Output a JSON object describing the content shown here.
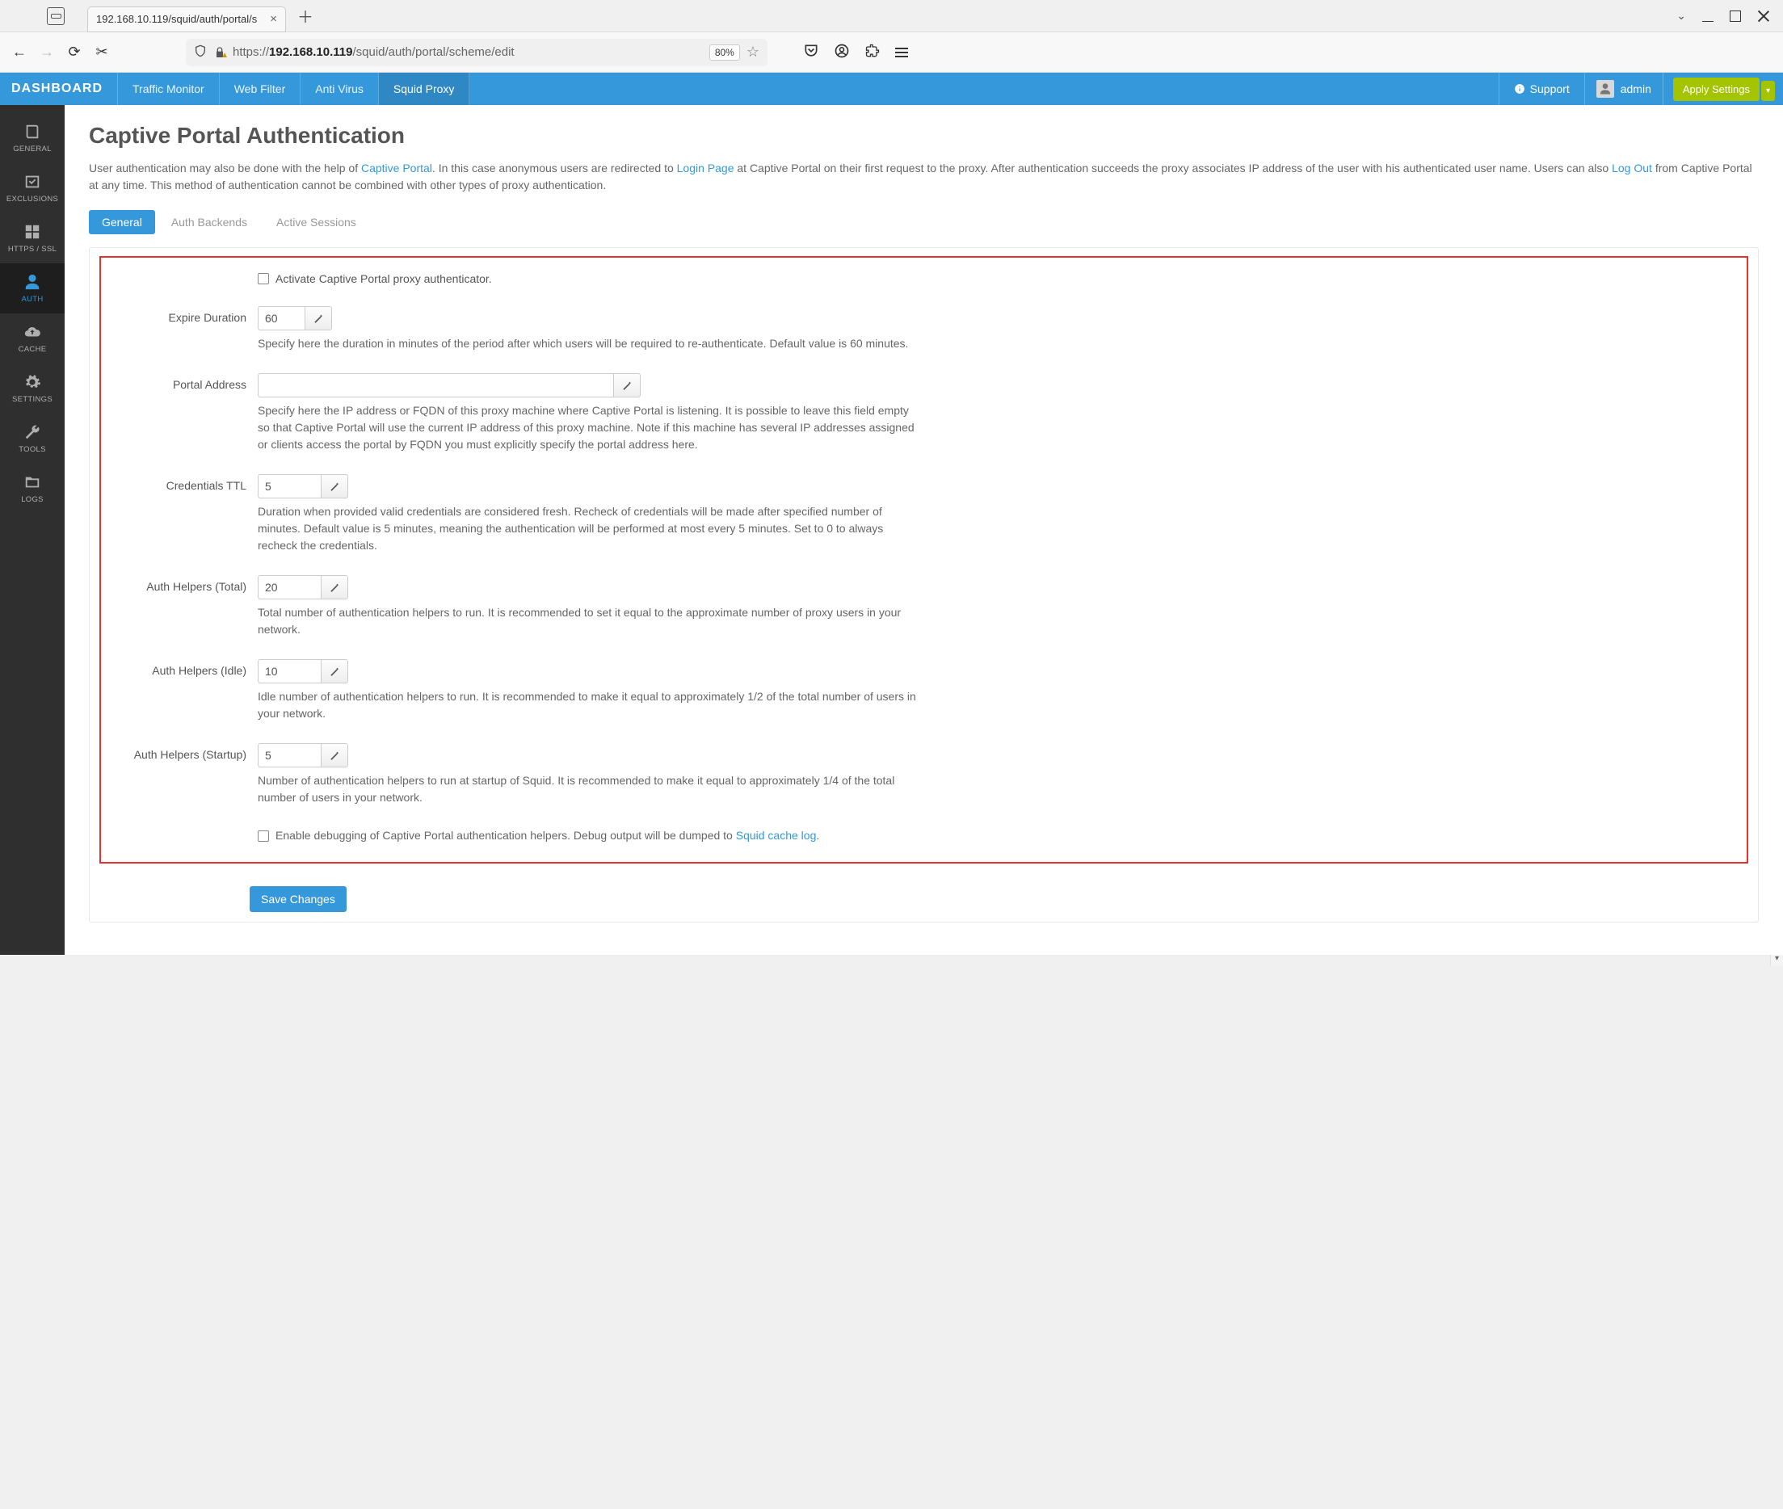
{
  "browser": {
    "tab_title": "192.168.10.119/squid/auth/portal/s",
    "url_prefix": "https://",
    "url_host": "192.168.10.119",
    "url_path": "/squid/auth/portal/scheme/edit",
    "zoom": "80%"
  },
  "topbar": {
    "brand": "DASHBOARD",
    "nav": {
      "traffic": "Traffic Monitor",
      "webfilter": "Web Filter",
      "antivirus": "Anti Virus",
      "squid": "Squid Proxy"
    },
    "support": "Support",
    "user": "admin",
    "apply": "Apply Settings"
  },
  "sidebar": {
    "general": "GENERAL",
    "exclusions": "EXCLUSIONS",
    "httpsssl": "HTTPS / SSL",
    "auth": "AUTH",
    "cache": "CACHE",
    "settings": "SETTINGS",
    "tools": "TOOLS",
    "logs": "LOGS"
  },
  "page": {
    "title": "Captive Portal Authentication",
    "intro_1": "User authentication may also be done with the help of ",
    "link_cp": "Captive Portal",
    "intro_2": ". In this case anonymous users are redirected to ",
    "link_login": "Login Page",
    "intro_3": " at Captive Portal on their first request to the proxy. After authentication succeeds the proxy associates IP address of the user with his authenticated user name. Users can also ",
    "link_logout": "Log Out",
    "intro_4": " from Captive Portal at any time. This method of authentication cannot be combined with other types of proxy authentication."
  },
  "tabs": {
    "general": "General",
    "backends": "Auth Backends",
    "sessions": "Active Sessions"
  },
  "form": {
    "activate_label": "Activate Captive Portal proxy authenticator.",
    "expire_label": "Expire Duration",
    "expire_value": "60",
    "expire_help": "Specify here the duration in minutes of the period after which users will be required to re-authenticate. Default value is 60 minutes.",
    "portal_label": "Portal Address",
    "portal_value": "",
    "portal_help": "Specify here the IP address or FQDN of this proxy machine where Captive Portal is listening. It is possible to leave this field empty so that Captive Portal will use the current IP address of this proxy machine. Note if this machine has several IP addresses assigned or clients access the portal by FQDN you must explicitly specify the portal address here.",
    "ttl_label": "Credentials TTL",
    "ttl_value": "5",
    "ttl_help": "Duration when provided valid credentials are considered fresh. Recheck of credentials will be made after specified number of minutes. Default value is 5 minutes, meaning the authentication will be performed at most every 5 minutes. Set to 0 to always recheck the credentials.",
    "total_label": "Auth Helpers (Total)",
    "total_value": "20",
    "total_help": "Total number of authentication helpers to run. It is recommended to set it equal to the approximate number of proxy users in your network.",
    "idle_label": "Auth Helpers (Idle)",
    "idle_value": "10",
    "idle_help": "Idle number of authentication helpers to run. It is recommended to make it equal to approximately 1/2 of the total number of users in your network.",
    "startup_label": "Auth Helpers (Startup)",
    "startup_value": "5",
    "startup_help": "Number of authentication helpers to run at startup of Squid. It is recommended to make it equal to approximately 1/4 of the total number of users in your network.",
    "debug_label": "Enable debugging of Captive Portal authentication helpers. Debug output will be dumped to ",
    "debug_link": "Squid cache log",
    "debug_period": ".",
    "save": "Save Changes"
  }
}
